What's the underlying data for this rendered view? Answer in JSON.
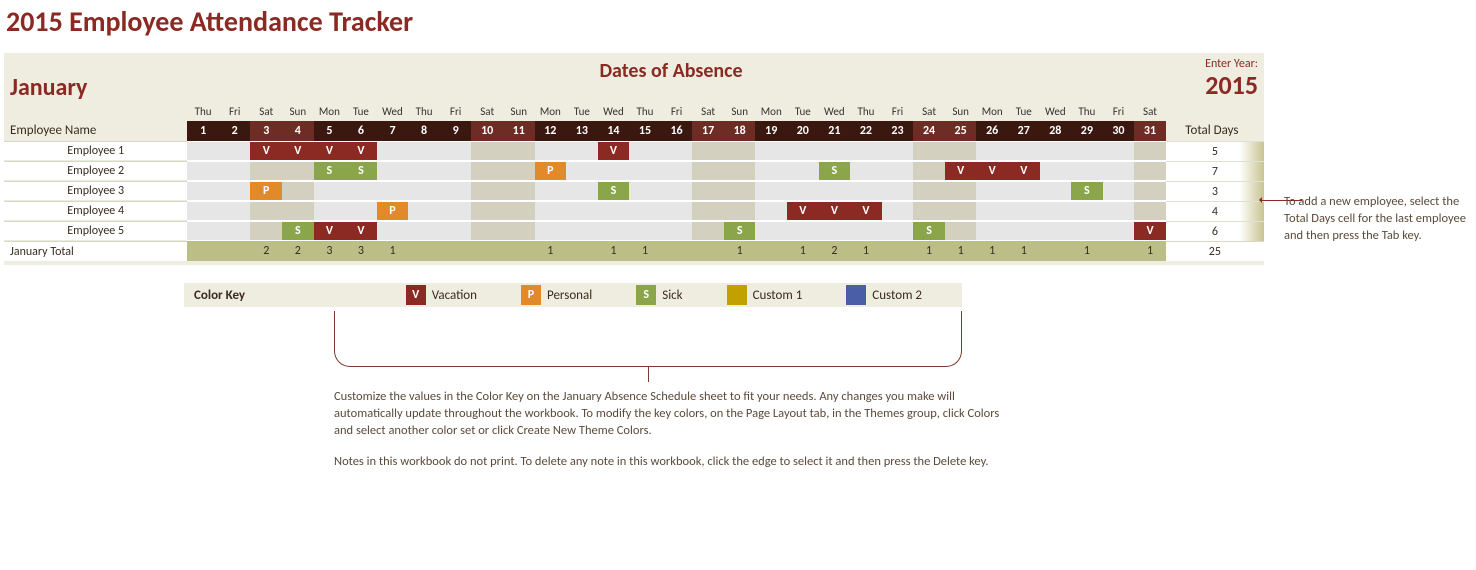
{
  "title": "2015 Employee Attendance Tracker",
  "month": "January",
  "header": "Dates of Absence",
  "year_label": "Enter Year:",
  "year": "2015",
  "name_header": "Employee Name",
  "total_header": "Total Days",
  "total_row_label": "January Total",
  "grand_total": 25,
  "days": [
    {
      "n": 1,
      "wd": "Thu"
    },
    {
      "n": 2,
      "wd": "Fri"
    },
    {
      "n": 3,
      "wd": "Sat"
    },
    {
      "n": 4,
      "wd": "Sun"
    },
    {
      "n": 5,
      "wd": "Mon"
    },
    {
      "n": 6,
      "wd": "Tue"
    },
    {
      "n": 7,
      "wd": "Wed"
    },
    {
      "n": 8,
      "wd": "Thu"
    },
    {
      "n": 9,
      "wd": "Fri"
    },
    {
      "n": 10,
      "wd": "Sat"
    },
    {
      "n": 11,
      "wd": "Sun"
    },
    {
      "n": 12,
      "wd": "Mon"
    },
    {
      "n": 13,
      "wd": "Tue"
    },
    {
      "n": 14,
      "wd": "Wed"
    },
    {
      "n": 15,
      "wd": "Thu"
    },
    {
      "n": 16,
      "wd": "Fri"
    },
    {
      "n": 17,
      "wd": "Sat"
    },
    {
      "n": 18,
      "wd": "Sun"
    },
    {
      "n": 19,
      "wd": "Mon"
    },
    {
      "n": 20,
      "wd": "Tue"
    },
    {
      "n": 21,
      "wd": "Wed"
    },
    {
      "n": 22,
      "wd": "Thu"
    },
    {
      "n": 23,
      "wd": "Fri"
    },
    {
      "n": 24,
      "wd": "Sat"
    },
    {
      "n": 25,
      "wd": "Sun"
    },
    {
      "n": 26,
      "wd": "Mon"
    },
    {
      "n": 27,
      "wd": "Tue"
    },
    {
      "n": 28,
      "wd": "Wed"
    },
    {
      "n": 29,
      "wd": "Thu"
    },
    {
      "n": 30,
      "wd": "Fri"
    },
    {
      "n": 31,
      "wd": "Sat"
    }
  ],
  "weekend_days": [
    3,
    4,
    10,
    11,
    17,
    18,
    24,
    25,
    31
  ],
  "employees": [
    {
      "name": "Employee 1",
      "total": 5,
      "marks": {
        "3": "V",
        "4": "V",
        "5": "V",
        "6": "V",
        "14": "V"
      }
    },
    {
      "name": "Employee 2",
      "total": 7,
      "marks": {
        "5": "S",
        "6": "S",
        "12": "P",
        "21": "S",
        "25": "V",
        "26": "V",
        "27": "V"
      }
    },
    {
      "name": "Employee 3",
      "total": 3,
      "marks": {
        "3": "P",
        "14": "S",
        "29": "S"
      }
    },
    {
      "name": "Employee 4",
      "total": 4,
      "marks": {
        "7": "P",
        "20": "V",
        "21": "V",
        "22": "V"
      }
    },
    {
      "name": "Employee 5",
      "total": 6,
      "marks": {
        "4": "S",
        "5": "V",
        "6": "V",
        "18": "S",
        "24": "S",
        "31": "V"
      }
    }
  ],
  "day_totals": {
    "3": 2,
    "4": 2,
    "5": 3,
    "6": 3,
    "7": 1,
    "12": 1,
    "14": 1,
    "15": 1,
    "18": 1,
    "20": 1,
    "21": 2,
    "22": 1,
    "24": 1,
    "25": 1,
    "26": 1,
    "27": 1,
    "29": 1,
    "31": 1
  },
  "key": {
    "label": "Color Key",
    "items": [
      {
        "code": "V",
        "name": "Vacation",
        "color": "#8a2a22"
      },
      {
        "code": "P",
        "name": "Personal",
        "color": "#e08a2a"
      },
      {
        "code": "S",
        "name": "Sick",
        "color": "#8ba64a"
      },
      {
        "code": "",
        "name": "Custom 1",
        "color": "#c2a000"
      },
      {
        "code": "",
        "name": "Custom 2",
        "color": "#4a5ea8"
      }
    ]
  },
  "note1": "Customize the values in the Color Key on the January Absence Schedule sheet to fit your needs. Any changes you make will automatically update throughout the workbook.  To modify the key colors, on the Page Layout tab, in the Themes group, click Colors and select another color set or click Create New Theme Colors.",
  "note2": "Notes in this workbook do not print. To delete any note in this workbook, click the edge to select it and then press the Delete key.",
  "annotation": "To add a new employee, select the Total Days cell for the last employee and then press the Tab key."
}
